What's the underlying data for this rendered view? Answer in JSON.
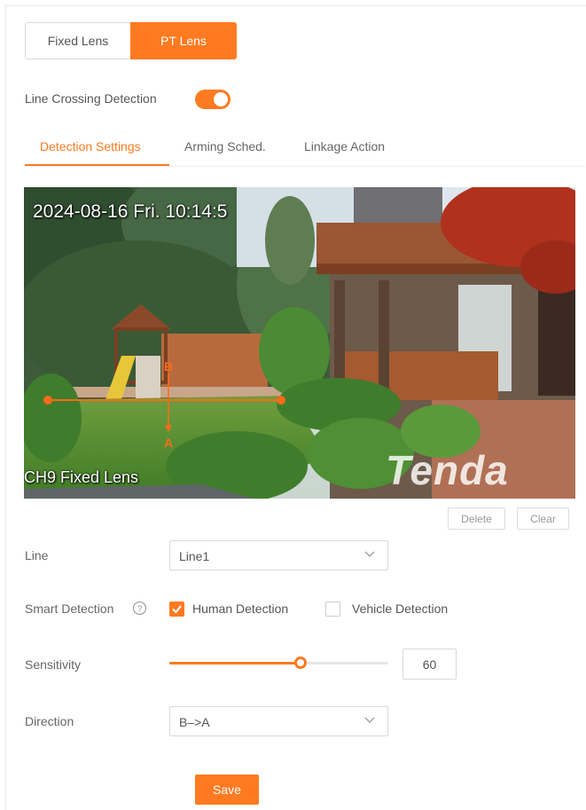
{
  "lens": {
    "fixed_label": "Fixed Lens",
    "pt_label": "PT Lens",
    "selected": "PT Lens"
  },
  "line_crossing": {
    "label": "Line Crossing Detection",
    "enabled": true
  },
  "tabs": [
    {
      "label": "Detection Settings",
      "active": true
    },
    {
      "label": "Arming Sched.",
      "active": false
    },
    {
      "label": "Linkage Action",
      "active": false
    }
  ],
  "video": {
    "timestamp": "2024-08-16 Fri. 10:14:5",
    "camera_name": "CH9 Fixed Lens",
    "watermark": "Tenda",
    "line_labels": {
      "b": "B",
      "a": "A"
    }
  },
  "actions": {
    "delete_label": "Delete",
    "clear_label": "Clear"
  },
  "form": {
    "line": {
      "label": "Line",
      "value": "Line1"
    },
    "smart_detection": {
      "label": "Smart Detection",
      "human": {
        "label": "Human Detection",
        "checked": true
      },
      "vehicle": {
        "label": "Vehicle Detection",
        "checked": false
      }
    },
    "sensitivity": {
      "label": "Sensitivity",
      "value": "60",
      "fraction": 0.6
    },
    "direction": {
      "label": "Direction",
      "value": "B–>A"
    }
  },
  "save_label": "Save",
  "colors": {
    "accent": "#ff7a21",
    "line": "#ff6a1a"
  },
  "icons": {
    "help": "question-circle-icon",
    "chevron": "chevron-down-icon",
    "check": "check-icon"
  }
}
